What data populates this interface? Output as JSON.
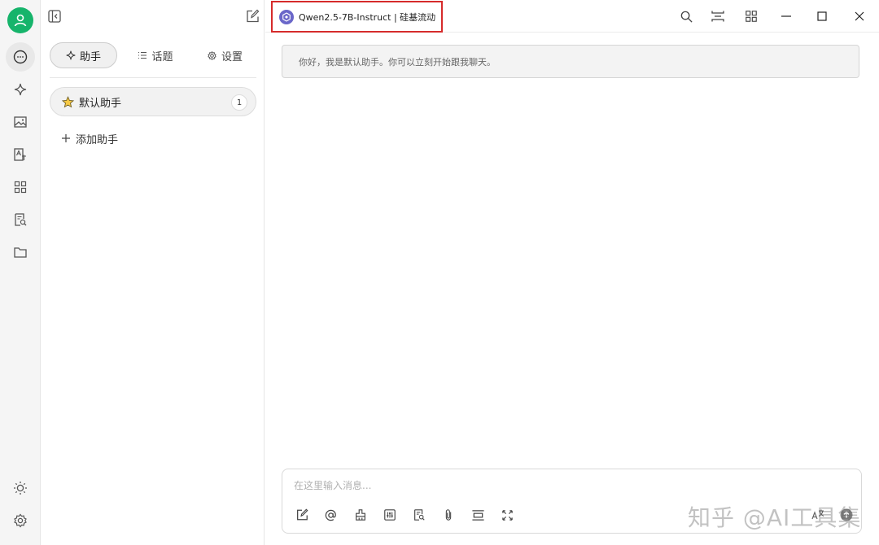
{
  "sidebar": {
    "icons": [
      "user-avatar",
      "chat-icon",
      "sparkle-icon",
      "image-icon",
      "translate-icon",
      "apps-icon",
      "doc-search-icon",
      "folder-icon",
      "sun-icon",
      "gear-icon"
    ]
  },
  "panel": {
    "tabs": [
      {
        "label": "助手",
        "icon": "sparkle-icon"
      },
      {
        "label": "话题",
        "icon": "list-icon"
      },
      {
        "label": "设置",
        "icon": "gear-icon"
      }
    ],
    "assistants": [
      {
        "name": "默认助手",
        "count": "1",
        "icon": "star-icon"
      }
    ],
    "add_assistant_label": "添加助手"
  },
  "header": {
    "model_name": "Qwen2.5-7B-Instruct | 硅基流动",
    "highlight_color": "#d62b2b"
  },
  "chat": {
    "greeting": "你好，我是默认助手。你可以立刻开始跟我聊天。"
  },
  "composer": {
    "placeholder": "在这里输入消息...",
    "tools": [
      "edit-icon",
      "at-icon",
      "clean-icon",
      "sliders-icon",
      "doc-search-icon",
      "paperclip-icon",
      "layout-icon",
      "expand-icon"
    ]
  },
  "watermark": "知乎 @AI工具集",
  "colors": {
    "accent_green": "#16b46b",
    "model_logo": "#6a67c9"
  }
}
